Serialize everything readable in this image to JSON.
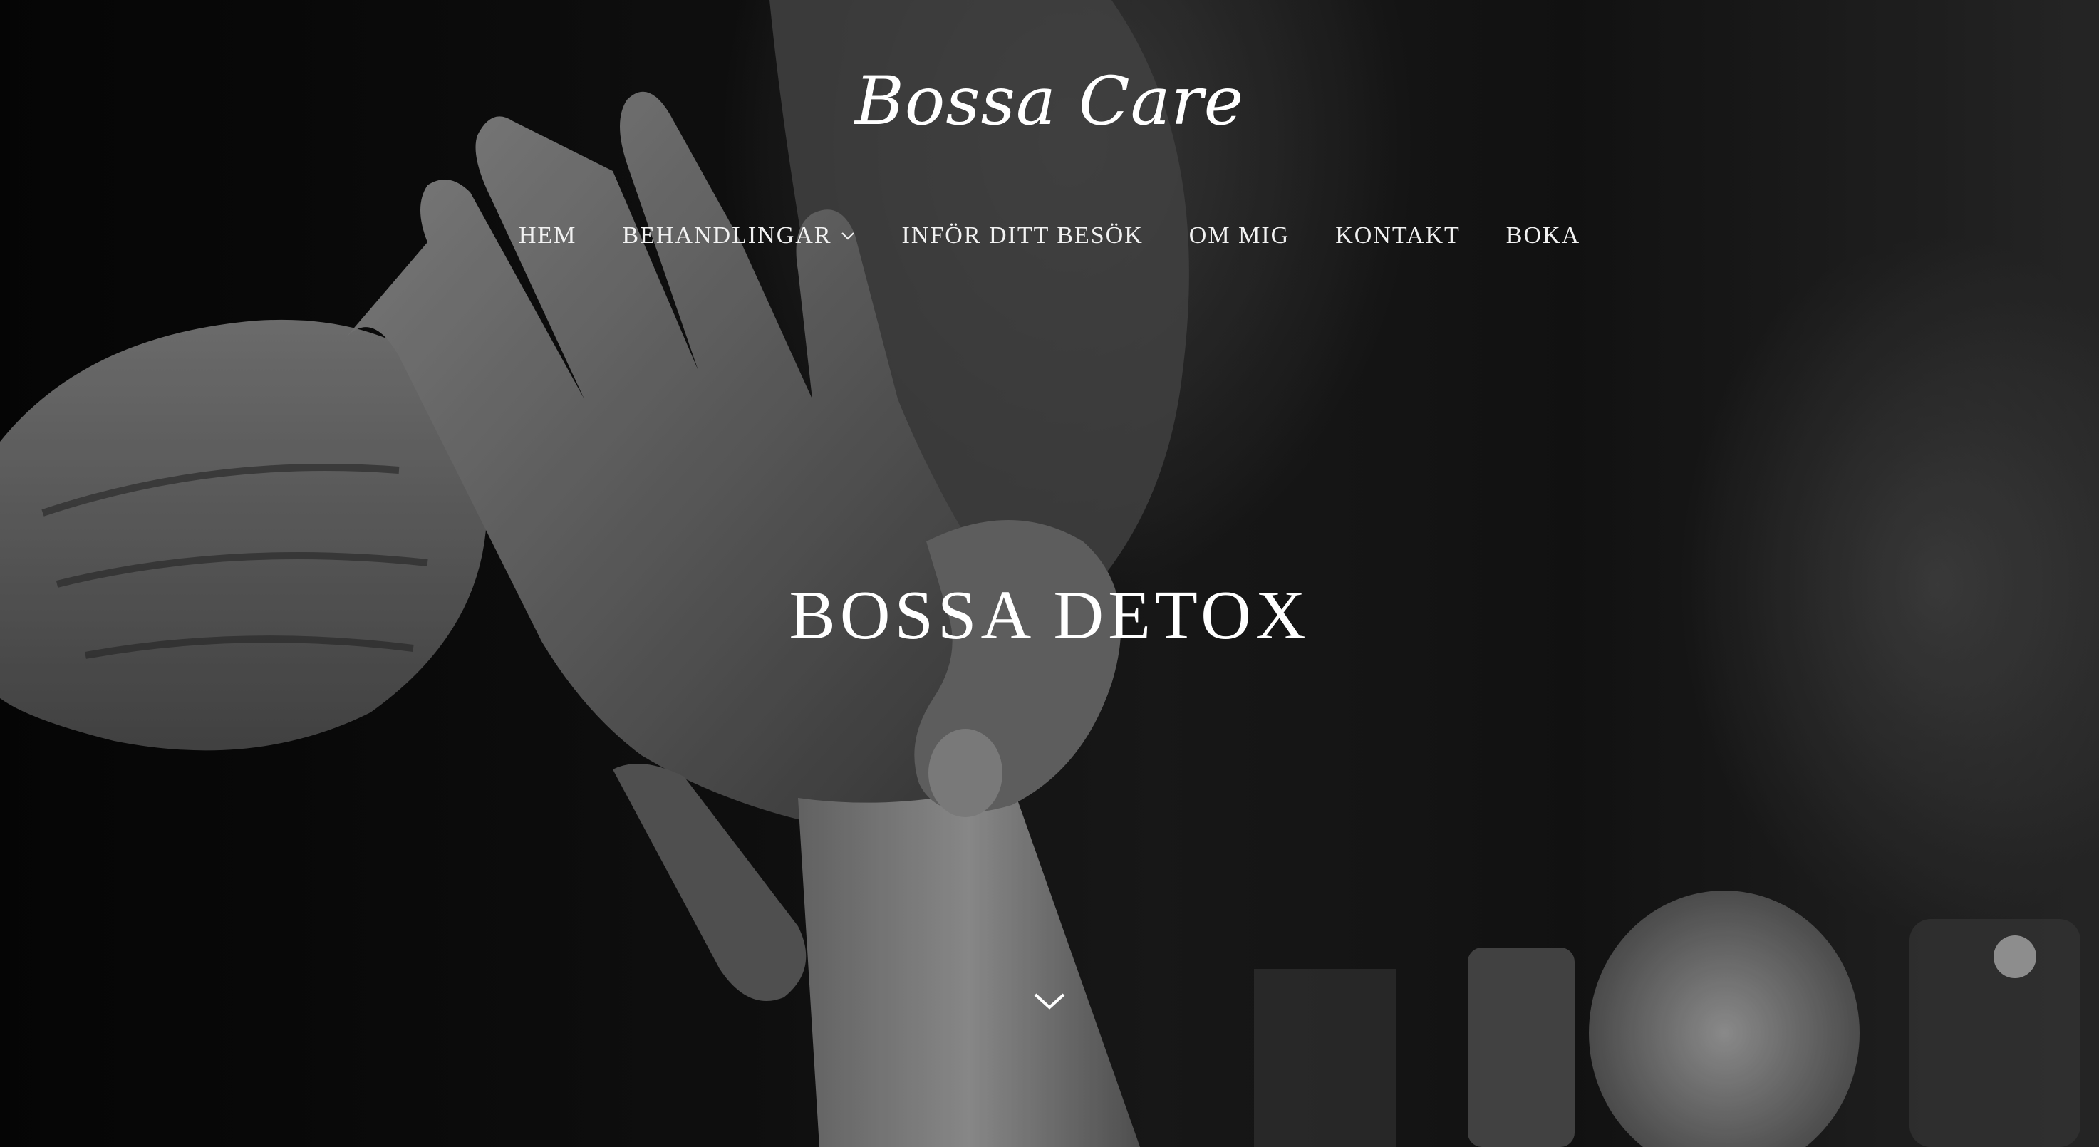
{
  "site": {
    "logo_text": "Bossa Care"
  },
  "nav": {
    "items": [
      {
        "label": "HEM",
        "has_dropdown": false
      },
      {
        "label": "BEHANDLINGAR",
        "has_dropdown": true
      },
      {
        "label": "INFÖR DITT BESÖK",
        "has_dropdown": false
      },
      {
        "label": "OM MIG",
        "has_dropdown": false
      },
      {
        "label": "KONTAKT",
        "has_dropdown": false
      },
      {
        "label": "BOKA",
        "has_dropdown": false
      }
    ]
  },
  "hero": {
    "title": "BOSSA DETOX",
    "image_subject": "black-and-white photo of hand massage",
    "scroll_icon": "chevron-down-icon"
  },
  "colors": {
    "text": "#ffffff",
    "background": "#0b0b0b"
  }
}
